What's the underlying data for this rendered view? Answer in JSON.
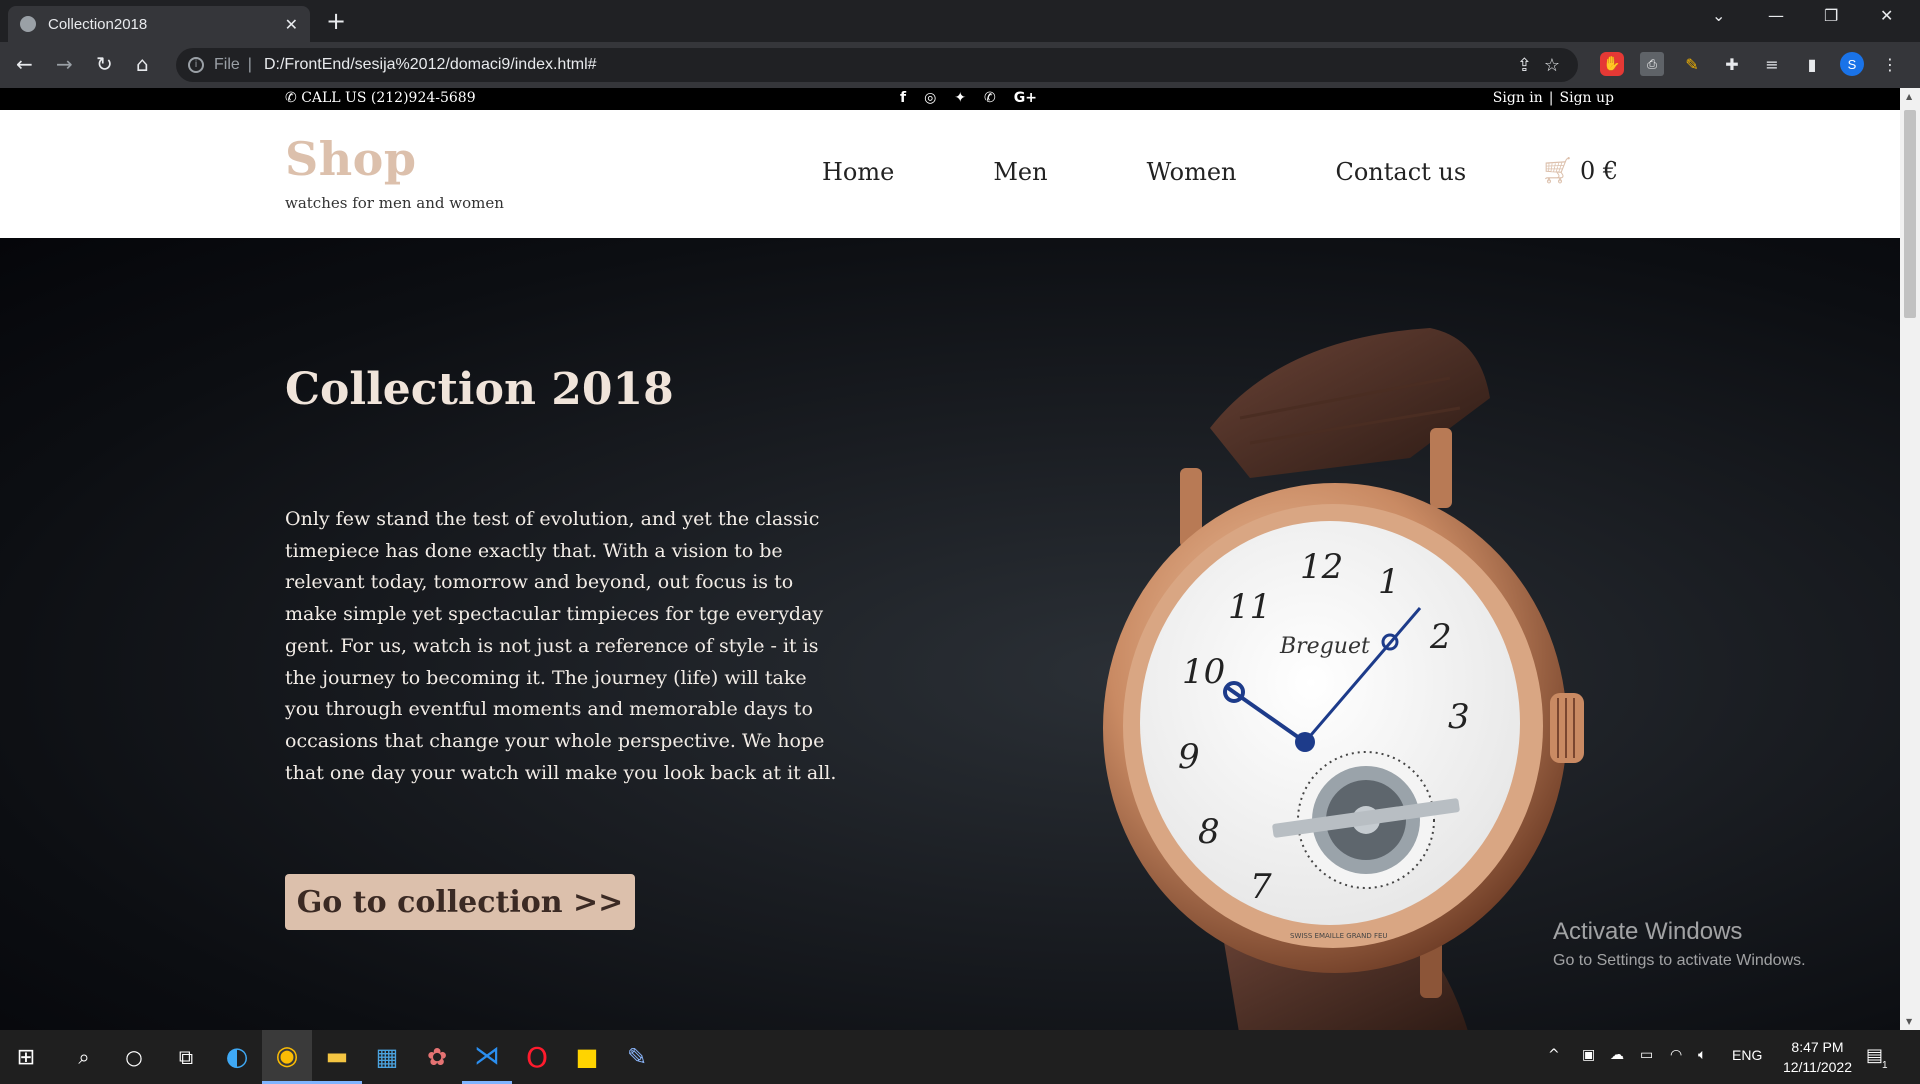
{
  "browser": {
    "tab_title": "Collection2018",
    "new_tab": "+",
    "url_scheme": "File",
    "url": "D:/FrontEnd/sesija%2012/domaci9/index.html#",
    "profile_initial": "S"
  },
  "site": {
    "topbar": {
      "phone": "CALL US (212)924-5689",
      "sign_in": "Sign in",
      "sign_up": "Sign up"
    },
    "logo": "Shop",
    "tagline": "watches for men and women",
    "nav": [
      "Home",
      "Men",
      "Women",
      "Contact us"
    ],
    "cart_total": "0 €",
    "hero": {
      "title": "Collection 2018",
      "body": "Only few stand the test of evolution, and yet the classic timepiece has done exactly that. With a vision to be relevant today, tomorrow and beyond, out focus is to make simple yet spectacular timpieces for tge everyday gent. For us, watch is not just a reference of style - it is the journey to becoming it. The journey (life) will take you through eventful moments and memorable days to occasions that change your whole perspective. We hope that one day your watch will make you look back at it all.",
      "button": "Go to collection >>",
      "watch_brand": "Breguet",
      "watch_dial_text": "SWISS EMAILLE GRAND FEU",
      "watch_numerals": [
        "12",
        "1",
        "2",
        "3",
        "9",
        "10",
        "11",
        "8",
        "7"
      ]
    }
  },
  "windows_watermark": {
    "title": "Activate Windows",
    "subtitle": "Go to Settings to activate Windows."
  },
  "taskbar": {
    "language": "ENG",
    "time": "8:47 PM",
    "date": "12/11/2022",
    "notifications": "1"
  },
  "colors": {
    "accent": "#dcc0ac",
    "hero_bg": "#0b0d11",
    "chrome_dark": "#202124"
  }
}
